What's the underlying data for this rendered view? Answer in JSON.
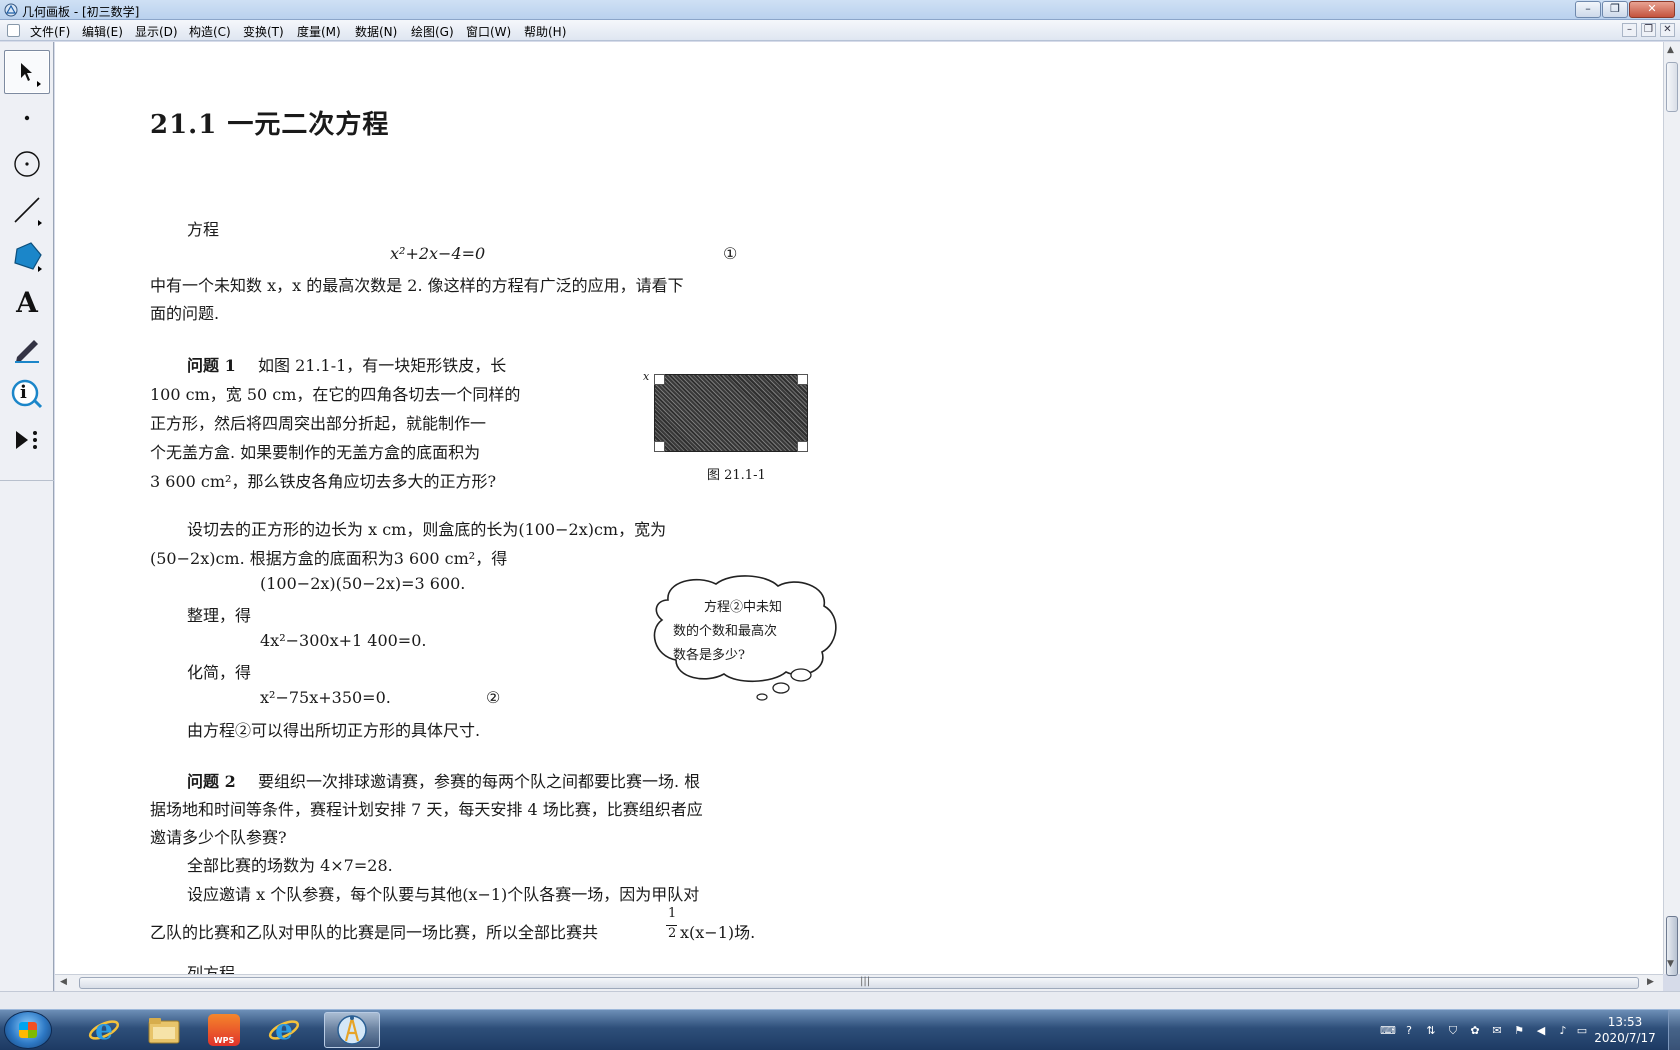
{
  "window": {
    "title": "几何画板 - [初三数学]"
  },
  "menu": [
    "文件(F)",
    "编辑(E)",
    "显示(D)",
    "构造(C)",
    "变换(T)",
    "度量(M)",
    "数据(N)",
    "绘图(G)",
    "窗口(W)",
    "帮助(H)"
  ],
  "tools": [
    "arrow-select-tool",
    "point-tool",
    "compass-tool",
    "straightedge-tool",
    "polygon-tool",
    "text-tool",
    "marker-tool",
    "information-tool",
    "custom-tool"
  ],
  "toolbox": {
    "text_tool_glyph": "A",
    "info_tool_glyph": "i"
  },
  "document": {
    "heading": "21.1  一元二次方程",
    "lines": [
      "方程",
      "x²+2x−4=0",
      "①",
      "中有一个未知数 x，x 的最高次数是 2. 像这样的方程有广泛的应用，请看下",
      "面的问题."
    ],
    "problem1": {
      "label": "问题 1",
      "lines": [
        "如图 21.1-1，有一块矩形铁皮，长",
        "100 cm，宽 50 cm，在它的四角各切去一个同样的",
        "正方形，然后将四周突出部分折起，就能制作一",
        "个无盖方盒. 如果要制作的无盖方盒的底面积为",
        "3 600 cm²，那么铁皮各角应切去多大的正方形?"
      ],
      "figure_caption": "图 21.1-1",
      "figure_x_label": "x",
      "solution": [
        "设切去的正方形的边长为 x cm，则盒底的长为(100−2x)cm，宽为",
        "(50−2x)cm. 根据方盒的底面积为3 600 cm²，得",
        "(100−2x)(50−2x)=3 600.",
        "整理，得",
        "4x²−300x+1 400=0.",
        "化简，得",
        "x²−75x+350=0.",
        "②",
        "由方程②可以得出所切正方形的具体尺寸."
      ],
      "thought_bubble": [
        "方程②中未知",
        "数的个数和最高次",
        "数各是多少?"
      ]
    },
    "problem2": {
      "label": "问题 2",
      "lines": [
        "要组织一次排球邀请赛，参赛的每两个队之间都要比赛一场. 根",
        "据场地和时间等条件，赛程计划安排 7 天，每天安排 4 场比赛，比赛组织者应",
        "邀请多少个队参赛?",
        "全部比赛的场数为 4×7=28.",
        "设应邀请 x 个队参赛，每个队要与其他(x−1)个队各赛一场，因为甲队对",
        "乙队的比赛和乙队对甲队的比赛是同一场比赛，所以全部比赛共",
        "1",
        "2",
        "x(x−1)场.",
        "列方程"
      ]
    }
  },
  "taskbar": {
    "apps": [
      "internet-explorer",
      "file-explorer",
      "wps-office",
      "internet-explorer-2",
      "geometers-sketchpad"
    ],
    "wps_label": "WPS",
    "clock_time": "13:53",
    "clock_date": "2020/7/17"
  },
  "colors": {
    "titlebar": "#b9d1ee",
    "taskbar": "#2e4f7a",
    "polygon_tool": "#1b86c9",
    "accent": "#1f5fa8"
  }
}
